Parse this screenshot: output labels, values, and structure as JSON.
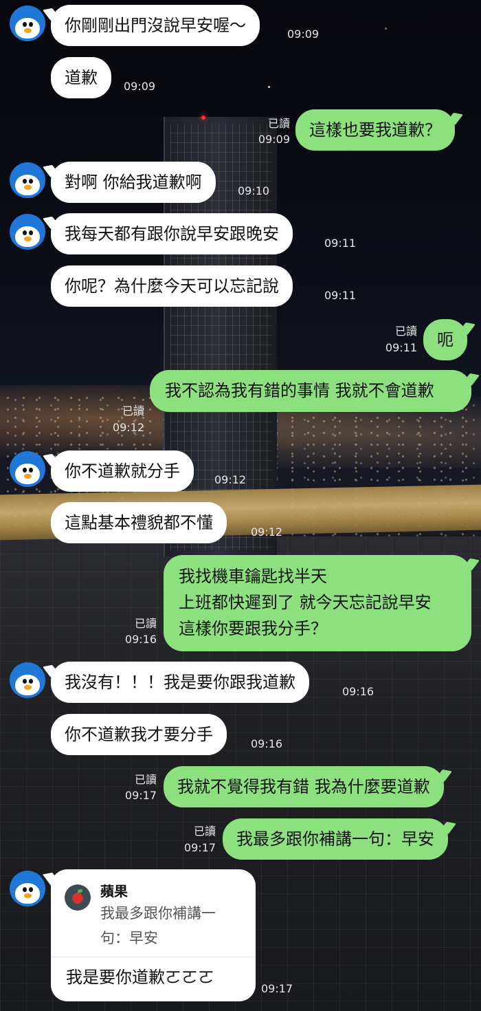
{
  "theme": {
    "bubble_in": "#ffffff",
    "bubble_out": "#8ce07e",
    "avatar_bg": "#1f78d8"
  },
  "contact": {
    "avatar_icon": "penguin-icon"
  },
  "messages": [
    {
      "side": "in",
      "text": "你剛剛出門沒說早安喔～",
      "time": "09:09"
    },
    {
      "side": "in",
      "text": "道歉",
      "time": "09:09"
    },
    {
      "side": "out",
      "text": "這樣也要我道歉？",
      "time": "09:09",
      "read": "已讀"
    },
    {
      "side": "in",
      "text": "對啊 你給我道歉啊",
      "time": "09:10"
    },
    {
      "side": "in",
      "text": "我每天都有跟你說早安跟晚安",
      "time": "09:11"
    },
    {
      "side": "in",
      "text": "你呢？為什麼今天可以忘記說",
      "time": "09:11"
    },
    {
      "side": "out",
      "text": "呃",
      "time": "09:11",
      "read": "已讀"
    },
    {
      "side": "out",
      "text": "我不認為我有錯的事情 我就不會道歉",
      "time": "09:12",
      "read": "已讀"
    },
    {
      "side": "in",
      "text": "你不道歉就分手",
      "time": "09:12"
    },
    {
      "side": "in",
      "text": "這點基本禮貌都不懂",
      "time": "09:12"
    },
    {
      "side": "out",
      "text": "我找機車鑰匙找半天\n上班都快遲到了 就今天忘記說早安\n這樣你要跟我分手？",
      "time": "09:16",
      "read": "已讀"
    },
    {
      "side": "in",
      "text": "我沒有！！！我是要你跟我道歉",
      "time": "09:16"
    },
    {
      "side": "in",
      "text": "你不道歉我才要分手",
      "time": "09:16"
    },
    {
      "side": "out",
      "text": "我就不覺得我有錯 我為什麼要道歉",
      "time": "09:17",
      "read": "已讀"
    },
    {
      "side": "out",
      "text": "我最多跟你補講一句：早安",
      "time": "09:17",
      "read": "已讀"
    }
  ],
  "reply": {
    "quote_icon": "apple-icon",
    "quote_name": "蘋果",
    "quote_text": "我最多跟你補講一句：早安",
    "text": "我是要你道歉ㄛㄛㄛ",
    "time": "09:17"
  }
}
